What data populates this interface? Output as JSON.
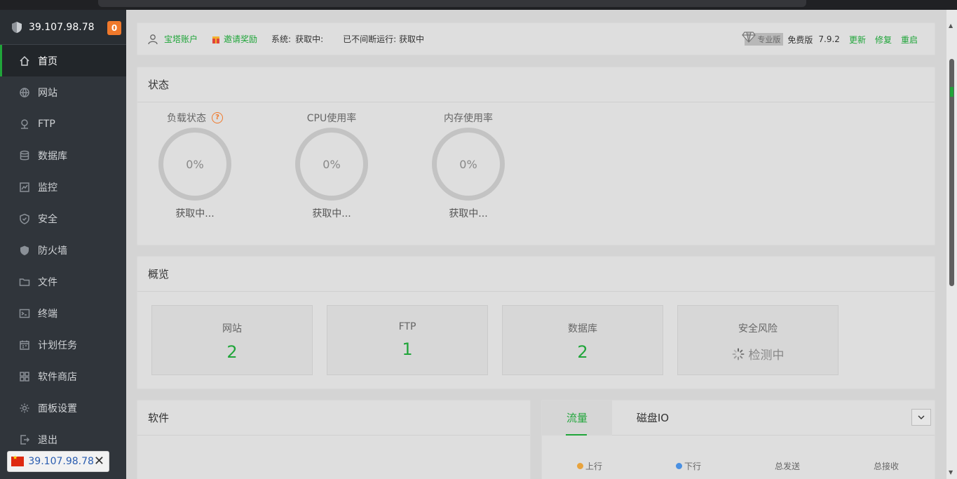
{
  "sidebar": {
    "server_ip": "39.107.98.78",
    "message_count": "0",
    "items": [
      {
        "label": "首页",
        "icon": "home-icon"
      },
      {
        "label": "网站",
        "icon": "globe-icon"
      },
      {
        "label": "FTP",
        "icon": "ftp-icon"
      },
      {
        "label": "数据库",
        "icon": "database-icon"
      },
      {
        "label": "监控",
        "icon": "monitor-icon"
      },
      {
        "label": "安全",
        "icon": "shield-check-icon"
      },
      {
        "label": "防火墙",
        "icon": "firewall-icon"
      },
      {
        "label": "文件",
        "icon": "folder-icon"
      },
      {
        "label": "终端",
        "icon": "terminal-icon"
      },
      {
        "label": "计划任务",
        "icon": "calendar-icon"
      },
      {
        "label": "软件商店",
        "icon": "apps-icon"
      },
      {
        "label": "面板设置",
        "icon": "settings-icon"
      },
      {
        "label": "退出",
        "icon": "logout-icon"
      }
    ],
    "active_index": 0
  },
  "ip_chip": {
    "ip": "39.107.98.78"
  },
  "topbar": {
    "account": "宝塔账户",
    "invite": "邀请奖励",
    "system_label": "系统:",
    "system_value": "获取中:",
    "uptime": "已不间断运行: 获取中",
    "pro_tag": "专业版",
    "edition": "免费版",
    "version": "7.9.2",
    "update": "更新",
    "repair": "修复",
    "restart": "重启"
  },
  "status": {
    "title": "状态",
    "gauges": [
      {
        "label": "负载状态",
        "value": "0%",
        "sub": "获取中..."
      },
      {
        "label": "CPU使用率",
        "value": "0%",
        "sub": "获取中..."
      },
      {
        "label": "内存使用率",
        "value": "0%",
        "sub": "获取中..."
      }
    ]
  },
  "overview": {
    "title": "概览",
    "boxes": [
      {
        "label": "网站",
        "value": "2"
      },
      {
        "label": "FTP",
        "value": "1"
      },
      {
        "label": "数据库",
        "value": "2"
      },
      {
        "label": "安全风险",
        "value": "检测中"
      }
    ]
  },
  "software": {
    "title": "软件"
  },
  "traffic": {
    "tabs": [
      "流量",
      "磁盘IO"
    ],
    "legend": [
      {
        "label": "上行",
        "color": "#e8a33d"
      },
      {
        "label": "下行",
        "color": "#4a90e2"
      },
      {
        "label": "总发送"
      },
      {
        "label": "总接收"
      }
    ]
  },
  "colors": {
    "accent": "#20a53a",
    "badge": "#f0792b",
    "sidebar": "#30353b"
  }
}
